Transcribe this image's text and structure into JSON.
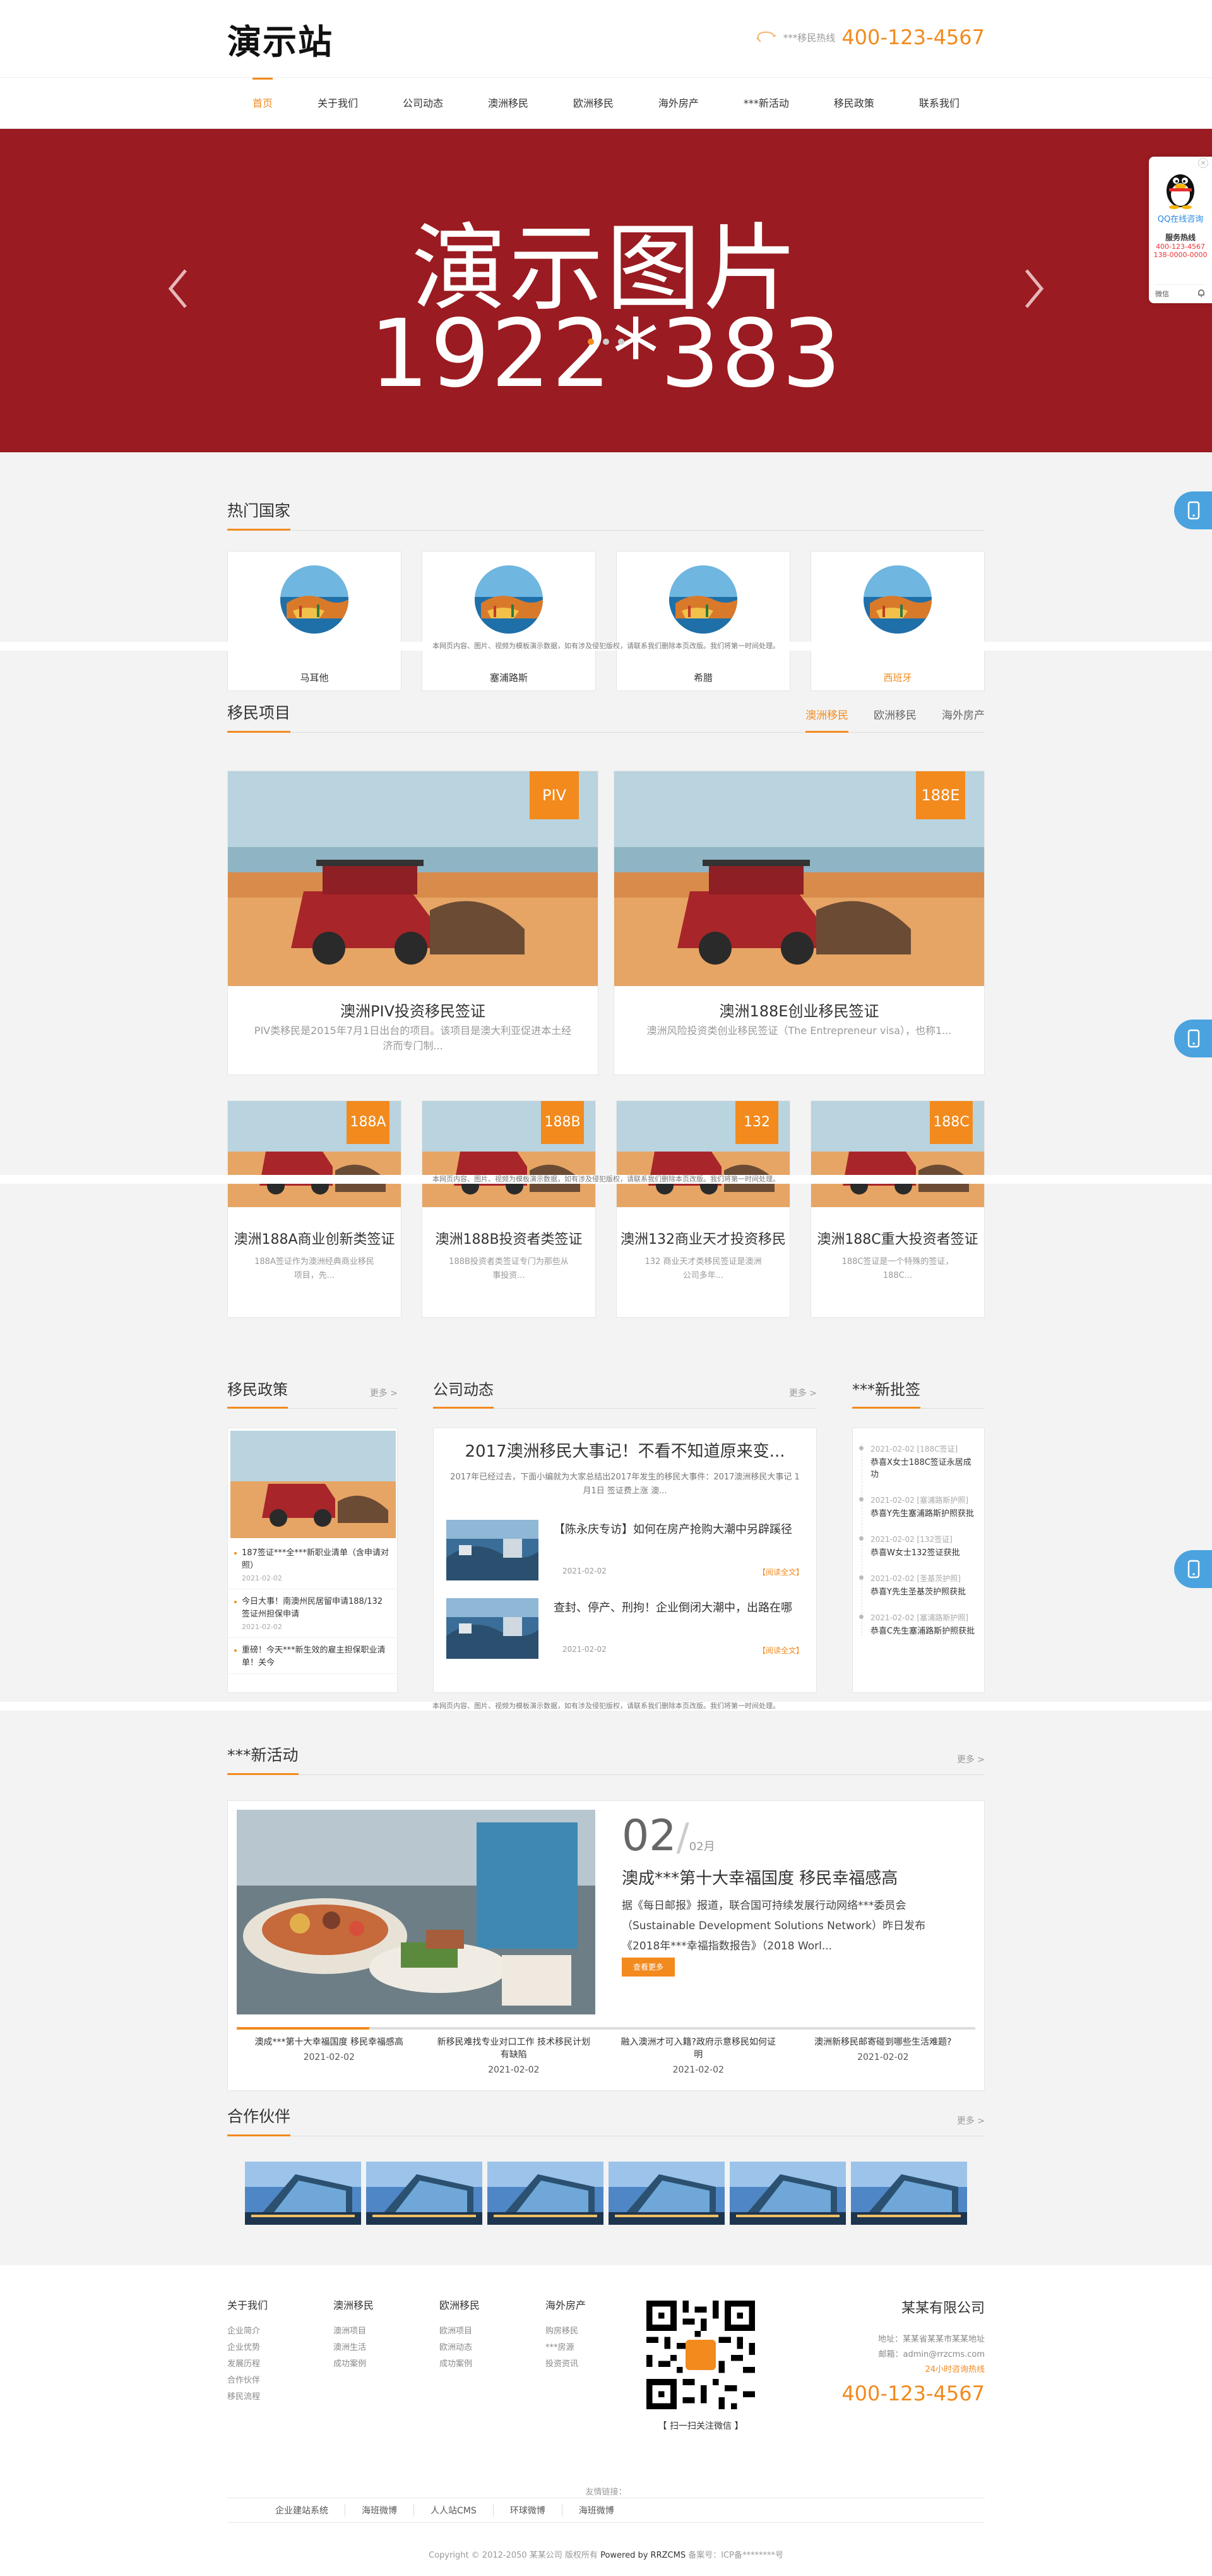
{
  "header": {
    "logo": "演示站",
    "hotline_label": "***移民热线",
    "hotline_number": "400-123-4567"
  },
  "nav": [
    "首页",
    "关于我们",
    "公司动态",
    "澳洲移民",
    "欧洲移民",
    "海外房产",
    "***新活动",
    "移民政策",
    "联系我们"
  ],
  "banner": {
    "line1": "演示图片",
    "line2": "1922*383"
  },
  "qq_panel": {
    "label": "QQ在线咨询",
    "service_label": "服务热线",
    "phone1": "400-123-4567",
    "phone2": "138-0000-0000",
    "wechat_label": "微信"
  },
  "notice_strip": "本网页内容、图片、视频为模板演示数据，如有涉及侵犯版权，请联系我们删除本页改版。我们将第一时间处理。",
  "hot_countries": {
    "title": "热门国家",
    "items": [
      {
        "name": "马耳他",
        "highlight": false
      },
      {
        "name": "塞浦路斯",
        "highlight": false
      },
      {
        "name": "希腊",
        "highlight": false
      },
      {
        "name": "西班牙",
        "highlight": true
      }
    ]
  },
  "projects": {
    "title": "移民项目",
    "tabs": [
      "澳洲移民",
      "欧洲移民",
      "海外房产"
    ],
    "big": [
      {
        "tag": "PIV",
        "title": "澳洲PIV投资移民签证",
        "desc": "PIV类移民是2015年7月1日出台的项目。该项目是澳大利亚促进本土经济而专门制..."
      },
      {
        "tag": "188E",
        "title": "澳洲188E创业移民签证",
        "desc": "澳洲风险投资类创业移民签证（The Entrepreneur visa），也称1..."
      }
    ],
    "small": [
      {
        "tag": "188A",
        "title": "澳洲188A商业创新类签证",
        "desc": "188A签证作为澳洲经典商业移民项目，先..."
      },
      {
        "tag": "188B",
        "title": "澳洲188B投资者类签证",
        "desc": "188B投资者类签证专门为那些从事投资..."
      },
      {
        "tag": "132",
        "title": "澳洲132商业天才投资移民",
        "desc": "132 商业天才类移民签证是澳洲公司多年..."
      },
      {
        "tag": "188C",
        "title": "澳洲188C重大投资者签证",
        "desc": "188C签证是一个特殊的签证，188C..."
      }
    ]
  },
  "policy": {
    "title": "移民政策",
    "more": "更多 >",
    "items": [
      {
        "text": "187签证***全***新职业清单（含申请对照）",
        "date": "2021-02-02"
      },
      {
        "text": "今日大事！南澳州民居留申请188/132签证州担保申请",
        "date": "2021-02-02"
      },
      {
        "text": "重磅！今天***新生效的雇主担保职业清单！关今",
        "date": ""
      }
    ]
  },
  "news": {
    "title": "公司动态",
    "more": "更多 >",
    "headline": "2017澳洲移民大事记！不看不知道原来变...",
    "headline_desc": "2017年已经过去，下面小编就为大家总结出2017年发生的移民大事件：2017澳洲移民大事记 1月1日 签证费上涨 澳...",
    "items": [
      {
        "title": "【陈永庆专访】如何在房产抢购大潮中另辟蹊径",
        "date": "2021-02-02",
        "read": "【阅读全文】"
      },
      {
        "title": "查封、停产、刑拘！企业倒闭大潮中，出路在哪",
        "date": "2021-02-02",
        "read": "【阅读全文】"
      }
    ]
  },
  "approvals": {
    "title": "***新批签",
    "items": [
      {
        "date": "2021-02-02 [188C签证]",
        "text": "恭喜X女士188C签证永居成功"
      },
      {
        "date": "2021-02-02 [塞浦路斯护照]",
        "text": "恭喜Y先生塞浦路斯护照获批"
      },
      {
        "date": "2021-02-02 [132签证]",
        "text": "恭喜W女士132签证获批"
      },
      {
        "date": "2021-02-02 [圣基茨护照]",
        "text": "恭喜Y先生圣基茨护照获批"
      },
      {
        "date": "2021-02-02 [塞浦路斯护照]",
        "text": "恭喜C先生塞浦路斯护照获批"
      }
    ]
  },
  "activities": {
    "title": "***新活动",
    "more": "更多 >",
    "day": "02",
    "month": "02月",
    "headline": "澳成***第十大幸福国度 移民幸福感高",
    "desc": "据《每日邮报》报道，联合国可持续发展行动网络***委员会（Sustainable Development Solutions Network）昨日发布《2018年***幸福指数报告》（2018 Worl...",
    "button": "查看更多",
    "tabs": [
      {
        "title": "澳成***第十大幸福国度 移民幸福感高",
        "date": "2021-02-02"
      },
      {
        "title": "新移民难找专业对口工作 技术移民计划有缺陷",
        "date": "2021-02-02"
      },
      {
        "title": "融入澳洲才可入籍?政府示意移民如何证明",
        "date": "2021-02-02"
      },
      {
        "title": "澳洲新移民邮寄碰到哪些生活难题?",
        "date": "2021-02-02"
      }
    ]
  },
  "partners": {
    "title": "合作伙伴",
    "more": "更多 >"
  },
  "footer": {
    "cols": [
      {
        "title": "关于我们",
        "items": [
          "企业简介",
          "企业优势",
          "发展历程",
          "合作伙伴",
          "移民流程"
        ]
      },
      {
        "title": "澳洲移民",
        "items": [
          "澳洲项目",
          "澳洲生活",
          "成功案例"
        ]
      },
      {
        "title": "欧洲移民",
        "items": [
          "欧洲项目",
          "欧洲动态",
          "成功案例"
        ]
      },
      {
        "title": "海外房产",
        "items": [
          "购房移民",
          "***房源",
          "投资资讯"
        ]
      }
    ],
    "qr_caption": "【 扫一扫关注微信 】",
    "company": "某某有限公司",
    "address": "地址：某某省某某市某某地址",
    "email": "邮箱：admin@rrzcms.com",
    "service": "24小时咨询热线",
    "tel": "400-123-4567",
    "links_label": "友情链接：",
    "links": [
      "企业建站系统",
      "海班微博",
      "人人站CMS",
      "环球微博",
      "海班微博"
    ],
    "copyright": "Copyright © 2012-2050 某某公司 版权所有",
    "powered": "Powered by RRZCMS",
    "icp": "备案号：ICP备********号"
  }
}
